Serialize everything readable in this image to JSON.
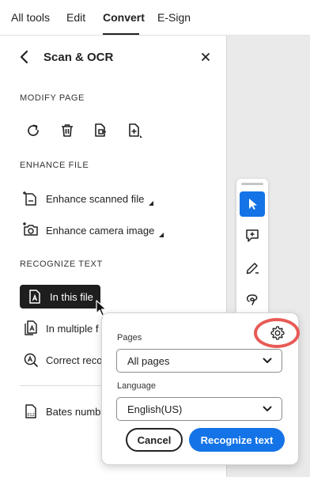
{
  "top_tabs": [
    {
      "label": "All tools"
    },
    {
      "label": "Edit"
    },
    {
      "label": "Convert"
    },
    {
      "label": "E-Sign"
    }
  ],
  "active_tab": "Convert",
  "panel": {
    "title": "Scan & OCR",
    "back_icon": "chevron-left-icon",
    "close_icon": "close-icon"
  },
  "modify_page": {
    "heading": "MODIFY PAGE",
    "icons": [
      "rotate-icon",
      "delete-icon",
      "extract-page-icon",
      "insert-page-icon"
    ]
  },
  "enhance_file": {
    "heading": "ENHANCE FILE",
    "items": [
      {
        "label": "Enhance scanned file",
        "icon": "enhance-scanned-icon"
      },
      {
        "label": "Enhance camera image",
        "icon": "camera-icon"
      }
    ]
  },
  "recognize_text": {
    "heading": "RECOGNIZE TEXT",
    "items": [
      {
        "label": "In this file",
        "icon": "text-file-icon"
      },
      {
        "label": "In multiple f",
        "icon": "multiple-files-icon"
      },
      {
        "label": "Correct reco",
        "icon": "correct-text-icon"
      }
    ]
  },
  "bates": {
    "label": "Bates numb",
    "icon": "bates-icon"
  },
  "vertical_toolbar": {
    "icons": [
      "select-cursor-icon",
      "add-comment-icon",
      "highlight-pen-icon",
      "draw-lasso-icon"
    ]
  },
  "popover": {
    "pages_label": "Pages",
    "pages_value": "All pages",
    "language_label": "Language",
    "language_value": "English(US)",
    "cancel_label": "Cancel",
    "primary_label": "Recognize text",
    "settings_icon": "gear-icon"
  },
  "colors": {
    "accent": "#1473e6",
    "highlight_ring": "#e85a55",
    "selected_bg": "#1e1e1e",
    "canvas_bg": "#eaeaea"
  }
}
